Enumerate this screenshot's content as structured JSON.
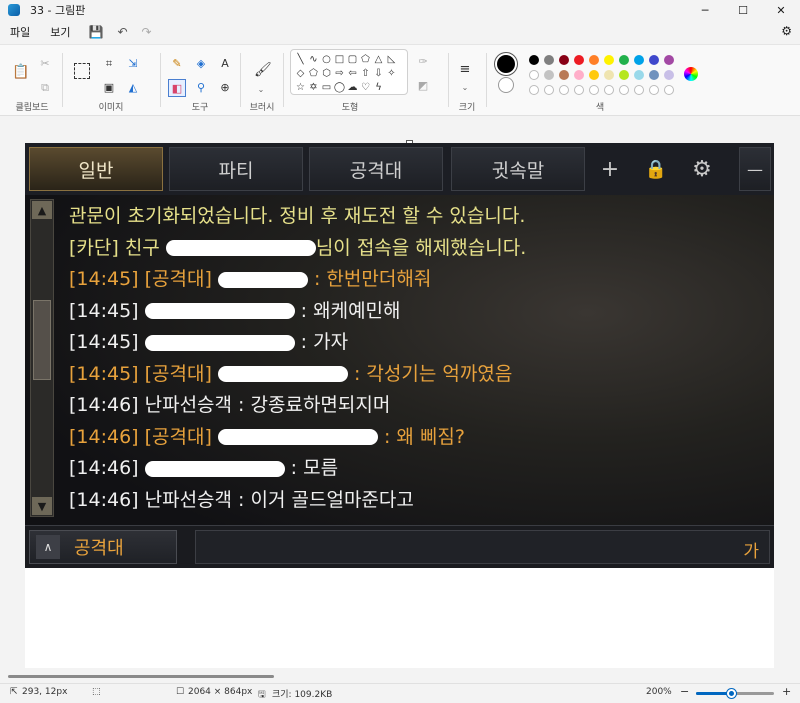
{
  "window": {
    "title": "33 - 그림판",
    "minimize": "─",
    "maximize": "☐",
    "close": "✕"
  },
  "menu": {
    "file": "파일",
    "view": "보기",
    "save_icon": "💾",
    "undo_icon": "↶",
    "redo_icon": "↷",
    "share_icon": "⚙"
  },
  "ribbon": {
    "groups": {
      "clipboard": "클립보드",
      "image": "이미지",
      "tools": "도구",
      "brushes": "브러시",
      "shapes": "도형",
      "size": "크기",
      "colors": "색"
    },
    "colors_row1": [
      "#000000",
      "#7f7f7f",
      "#880015",
      "#ed1c24",
      "#ff7f27",
      "#fff200",
      "#22b14c",
      "#00a2e8",
      "#3f48cc",
      "#a349a4"
    ],
    "colors_row2": [
      "#ffffff",
      "#c3c3c3",
      "#b97a57",
      "#ffaec9",
      "#ffc90e",
      "#efe4b0",
      "#b5e61d",
      "#99d9ea",
      "#7092be",
      "#c8bfe7"
    ]
  },
  "game": {
    "tabs": [
      "일반",
      "파티",
      "공격대",
      "귓속말"
    ],
    "tab_icons": {
      "add": "+",
      "lock": "🔒",
      "settings": "⚙",
      "minimize": "—"
    },
    "scroll": {
      "up": "▲",
      "down": "▼"
    },
    "lines": [
      {
        "color": "yellow",
        "before": "관문이 초기화되었습니다. 정비 후 재도전 할 수 있습니다.",
        "redact": 0,
        "after": ""
      },
      {
        "color": "yellow",
        "before": "[카단] 친구 ",
        "redact": 150,
        "after": "님이 접속을 해제했습니다."
      },
      {
        "color": "orange",
        "before": "[14:45] [공격대] ",
        "redact": 90,
        "after": " : 한번만더해줘"
      },
      {
        "color": "white",
        "before": "[14:45] ",
        "redact": 150,
        "after": " : 왜케예민해"
      },
      {
        "color": "white",
        "before": "[14:45] ",
        "redact": 150,
        "after": " : 가자"
      },
      {
        "color": "orange",
        "before": "[14:45] [공격대] ",
        "redact": 130,
        "after": " : 각성기는 억까였음"
      },
      {
        "color": "white",
        "before": "[14:46] 난파선승객 : 강종료하면되지머",
        "redact": 0,
        "after": ""
      },
      {
        "color": "orange",
        "before": "[14:46] [공격대] ",
        "redact": 160,
        "after": " : 왜 삐짐?"
      },
      {
        "color": "white",
        "before": "[14:46] ",
        "redact": 140,
        "after": " : 모름"
      },
      {
        "color": "white",
        "before": "[14:46] 난파선승객 : 이거 골드얼마준다고",
        "redact": 0,
        "after": ""
      }
    ],
    "input": {
      "channel_arrow": "∧",
      "channel": "공격대",
      "ime": "가"
    }
  },
  "status": {
    "cursor": "293, 12px",
    "selection_icon": "⬚",
    "dimensions": "2064 × 864px",
    "size": "크기: 109.2KB",
    "zoom": "200%",
    "zoom_out": "−",
    "zoom_in": "+",
    "zoom_level": 0.45
  }
}
